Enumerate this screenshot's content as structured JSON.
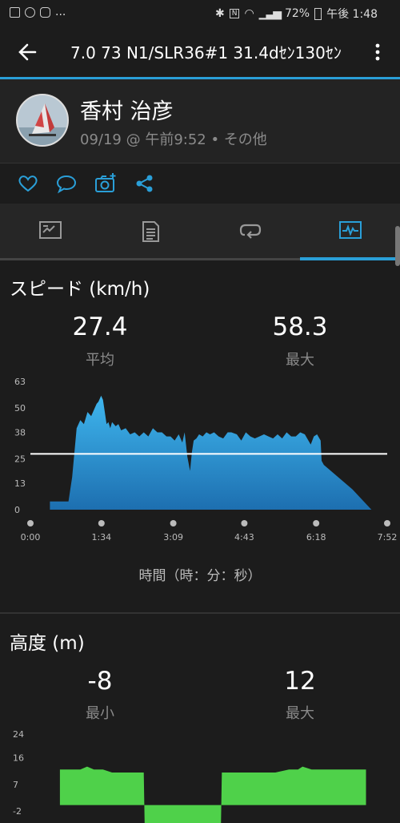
{
  "status_bar": {
    "left_ellipsis": "...",
    "battery": "72%",
    "time": "午後 1:48"
  },
  "header": {
    "title": "7.0 73 N1/SLR36#1 31.4dｾﾝ130ｾﾝ"
  },
  "profile": {
    "name": "香村 治彦",
    "meta": "09/19 @ 午前9:52 • その他"
  },
  "actions": [
    "heart-icon",
    "comment-icon",
    "camera-add-icon",
    "share-icon"
  ],
  "tabs": [
    "map-summary-tab",
    "details-tab",
    "laps-tab",
    "charts-tab"
  ],
  "speed": {
    "title": "スピード (km/h)",
    "avg_value": "27.4",
    "avg_label": "平均",
    "max_value": "58.3",
    "max_label": "最大",
    "x_axis_label": "時間（時：分：秒）"
  },
  "altitude": {
    "title": "高度 (m)",
    "min_value": "-8",
    "min_label": "最小",
    "max_value": "12",
    "max_label": "最大"
  },
  "chart_data": [
    {
      "type": "area",
      "title": "スピード (km/h)",
      "xlabel": "時間（時：分：秒）",
      "ylabel": "",
      "x_ticks": [
        "0:00",
        "1:34",
        "3:09",
        "4:43",
        "6:18",
        "7:52"
      ],
      "y_ticks": [
        "0",
        "13",
        "25",
        "38",
        "50",
        "63"
      ],
      "ylim": [
        0,
        63
      ],
      "reference_line": 27.4,
      "x_minutes": [
        0.43,
        0.43,
        0.84,
        0.92,
        1.02,
        1.1,
        1.18,
        1.26,
        1.34,
        1.42,
        1.46,
        1.5,
        1.56,
        1.6,
        1.64,
        1.68,
        1.72,
        1.76,
        1.8,
        1.88,
        1.94,
        2.0,
        2.1,
        2.2,
        2.3,
        2.4,
        2.5,
        2.6,
        2.7,
        2.8,
        2.9,
        3.0,
        3.09,
        3.18,
        3.27,
        3.35,
        3.4,
        3.46,
        3.52,
        3.56,
        3.6,
        3.66,
        3.72,
        3.8,
        3.88,
        3.96,
        4.05,
        4.15,
        4.25,
        4.35,
        4.43,
        4.55,
        4.65,
        4.75,
        4.85,
        4.95,
        5.05,
        5.15,
        5.25,
        5.35,
        5.45,
        5.55,
        5.65,
        5.75,
        5.85,
        5.95,
        6.05,
        6.18,
        6.25,
        6.32,
        6.4,
        6.42,
        6.47,
        7.1,
        7.52
      ],
      "values": [
        0,
        4,
        4,
        16,
        40,
        44,
        42,
        48,
        46,
        50,
        52,
        53,
        56,
        54,
        48,
        42,
        43,
        40,
        43,
        41,
        42,
        39,
        40,
        37,
        38,
        36,
        38,
        36,
        40,
        38,
        38,
        36,
        36,
        34,
        37,
        33,
        38,
        26,
        19,
        28,
        34,
        35,
        37,
        36,
        38,
        37,
        38,
        36,
        35,
        38,
        38,
        37,
        34,
        38,
        36,
        35,
        36,
        37,
        36,
        35,
        37,
        35,
        38,
        36,
        36,
        38,
        37,
        32,
        36,
        37,
        34,
        24,
        22,
        10,
        0
      ]
    },
    {
      "type": "area",
      "title": "高度 (m)",
      "y_ticks": [
        "-2",
        "7",
        "16",
        "24"
      ],
      "ylim": [
        -2,
        24
      ],
      "x_minutes": [
        0.65,
        0.9,
        1.1,
        1.25,
        1.4,
        1.6,
        1.8,
        2.1,
        2.4,
        2.5,
        2.52,
        3.05,
        4.2,
        4.22,
        4.5,
        4.8,
        5.1,
        5.4,
        5.7,
        5.9,
        6.0,
        6.2,
        6.5,
        7.0,
        7.4
      ],
      "values": [
        12,
        12,
        12,
        13,
        12,
        12,
        11,
        11,
        11,
        11,
        -8,
        -8,
        -8,
        11,
        11,
        11,
        11,
        11,
        12,
        12,
        13,
        12,
        12,
        12,
        12
      ]
    }
  ]
}
